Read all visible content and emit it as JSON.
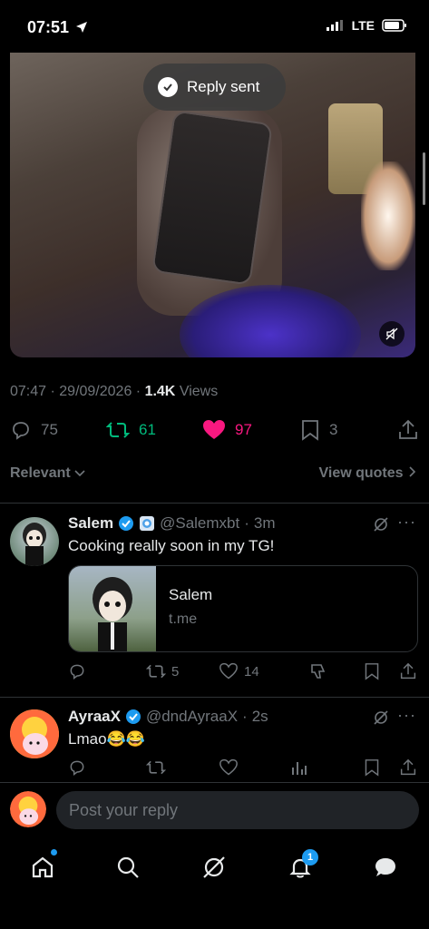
{
  "status_bar": {
    "time": "07:51",
    "network": "LTE"
  },
  "toast": {
    "text": "Reply sent"
  },
  "post": {
    "time": "07:47",
    "date": "29/09/2026",
    "views_count": "1.4K",
    "views_label": "Views",
    "replies": "75",
    "reposts": "61",
    "likes": "97",
    "bookmarks": "3"
  },
  "sort": {
    "label": "Relevant",
    "quotes_label": "View quotes"
  },
  "replies": [
    {
      "name": "Salem",
      "handle": "@Salemxbt",
      "time": "3m",
      "text": "Cooking really soon in my TG!",
      "card_title": "Salem",
      "card_domain": "t.me",
      "reposts": "5",
      "likes": "14"
    },
    {
      "name": "AyraaX",
      "handle": "@dndAyraaX",
      "time": "2s",
      "text": "Lmao😂😂"
    }
  ],
  "composer": {
    "placeholder": "Post your reply"
  },
  "tabbar": {
    "notifications_badge": "1"
  },
  "colors": {
    "accent": "#1d9bf0",
    "repost": "#00ba7c",
    "like": "#f91880",
    "muted": "#71767b"
  }
}
